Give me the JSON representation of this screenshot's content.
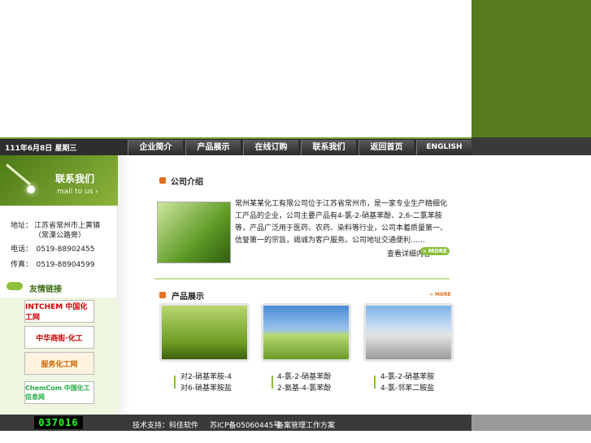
{
  "header": {
    "date_text": "111年6月8日 星期三"
  },
  "nav": {
    "items": [
      "企业简介",
      "产品展示",
      "在线订购",
      "联系我们",
      "返回首页",
      "ENGLISH"
    ]
  },
  "sidebar": {
    "contact_title": "联系我们",
    "contact_sub": "mail to us ›",
    "address_label": "地址：",
    "address_line1": "江苏省常州市上黄镇",
    "address_line2": "（常溧公路旁）",
    "phone": "电话：　0519-88902455",
    "fax": "传真：　0519-88904599",
    "links_title": "友情链接",
    "links": [
      "INTCHEM 中国化工网",
      "中华商街·化工",
      "服务化工网",
      "ChemCom 中国化工信息网"
    ]
  },
  "intro": {
    "title": "公司介绍",
    "text": "常州某某化工有限公司位于江苏省常州市，是一家专业生产精细化工产品的企业，公司主要产品有4-氯-2-硝基苯酚、2,6-二氯苯胺等，产品广泛用于医药、农药、染料等行业，公司本着质量第一、信誉第一的宗旨，竭诚为客户服务。公司地址交通便利……",
    "detail_link": "查看详细内容",
    "more": "» MORE"
  },
  "products": {
    "title": "产品展示",
    "more": "» MORE",
    "items": [
      {
        "line1": "对2-硝基苯胺-4",
        "line2": "对6-硝基苯胺盐"
      },
      {
        "line1": "4-氯-2-硝基苯酚",
        "line2": "2-氨基-4-氯苯酚"
      },
      {
        "line1": "4-氯-2-硝基苯胺",
        "line2": "4-氯-邻苯二胺盐"
      }
    ]
  },
  "footer": {
    "counter": "037016",
    "support": "技术支持：科佳软件",
    "icp": "苏ICP备05060445号",
    "record": "备案管理工作方案"
  },
  "colors": {
    "brand_green": "#577a1e",
    "accent_orange": "#e07020",
    "light_green": "#8bbf3a"
  }
}
